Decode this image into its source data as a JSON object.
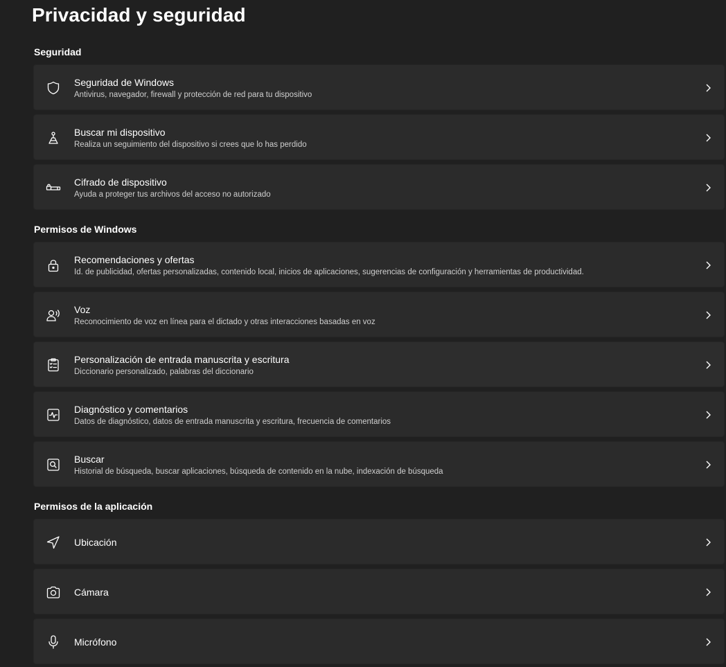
{
  "page": {
    "title": "Privacidad y seguridad"
  },
  "sections": {
    "security": {
      "title": "Seguridad",
      "items": [
        {
          "title": "Seguridad de Windows",
          "desc": "Antivirus, navegador, firewall y protección de red para tu dispositivo",
          "icon": "shield-icon"
        },
        {
          "title": "Buscar mi dispositivo",
          "desc": "Realiza un seguimiento del dispositivo si crees que lo has perdido",
          "icon": "find-device-icon"
        },
        {
          "title": "Cifrado de dispositivo",
          "desc": "Ayuda a proteger tus archivos del acceso no autorizado",
          "icon": "encryption-icon"
        }
      ]
    },
    "windows_permissions": {
      "title": "Permisos de Windows",
      "items": [
        {
          "title": "Recomendaciones y ofertas",
          "desc": "Id. de publicidad, ofertas personalizadas, contenido local, inicios de aplicaciones, sugerencias de configuración y herramientas de productividad.",
          "icon": "lock-icon"
        },
        {
          "title": "Voz",
          "desc": "Reconocimiento de voz en línea para el dictado y otras interacciones basadas en voz",
          "icon": "speech-icon"
        },
        {
          "title": "Personalización de entrada manuscrita y escritura",
          "desc": "Diccionario personalizado, palabras del diccionario",
          "icon": "clipboard-checklist-icon"
        },
        {
          "title": "Diagnóstico y comentarios",
          "desc": "Datos de diagnóstico, datos de entrada manuscrita y escritura, frecuencia de comentarios",
          "icon": "diagnostics-icon"
        },
        {
          "title": "Buscar",
          "desc": "Historial de búsqueda, buscar aplicaciones, búsqueda de contenido en la nube, indexación de búsqueda",
          "icon": "search-icon"
        }
      ]
    },
    "app_permissions": {
      "title": "Permisos de la aplicación",
      "items": [
        {
          "title": "Ubicación",
          "icon": "location-icon"
        },
        {
          "title": "Cámara",
          "icon": "camera-icon"
        },
        {
          "title": "Micrófono",
          "icon": "microphone-icon"
        }
      ]
    }
  },
  "colors": {
    "background": "#202020",
    "card": "#2b2b2b",
    "text_primary": "#ffffff",
    "text_secondary": "#cfcfcf"
  }
}
